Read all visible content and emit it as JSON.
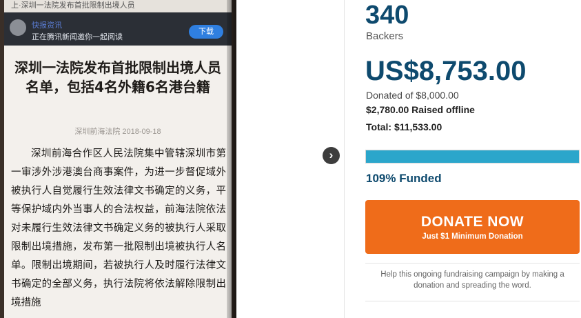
{
  "photo": {
    "top_strip": "上·深圳一法院发布首批限制出境人员",
    "app_name": "快报资讯",
    "app_invite": "正在腾讯新闻邀你一起阅读",
    "download_label": "下载",
    "headline": "深圳一法院发布首批限制出境人员名单，包括4名外籍6名港台籍",
    "meta": "深圳前海法院  2018-09-18",
    "body": "深圳前海合作区人民法院集中管辖深圳市第一审涉外涉港澳台商事案件，为进一步督促域外被执行人自觉履行生效法律文书确定的义务，平等保护域内外当事人的合法权益，前海法院依法对未履行生效法律文书确定义务的被执行人采取限制出境措施，发布第一批限制出境被执行人名单。限制出境期间，若被执行人及时履行法律文书确定的全部义务，执行法院将依法解除限制出境措施"
  },
  "nav": {
    "arrow_icon": "chevron-right-icon",
    "arrow_glyph": "›"
  },
  "stats": {
    "backers_count": "340",
    "backers_label": "Backers",
    "amount": "US$8,753.00",
    "donated_of": "Donated of $8,000.00",
    "raised_offline": "$2,780.00 Raised offline",
    "total": "Total: $11,533.00",
    "funded_percent": 109,
    "funded_label": "109% Funded"
  },
  "donate": {
    "label": "DONATE NOW",
    "sub_label": "Just $1 Minimum Donation"
  },
  "help_text": "Help this ongoing fundraising campaign by making a donation and spreading the word.",
  "colors": {
    "accent": "#0e4a6e",
    "progress": "#2ba6cb",
    "donate": "#ef6c1a"
  }
}
